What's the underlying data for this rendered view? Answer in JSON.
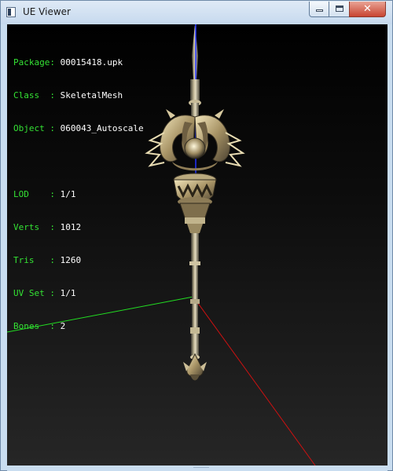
{
  "window": {
    "title": "UE Viewer"
  },
  "titlebar": {
    "min_icon": "minimize-icon",
    "max_icon": "maximize-icon",
    "close_icon": "close-icon",
    "close_glyph": "✕"
  },
  "info": {
    "package": {
      "key": "Package:",
      "value": "00015418.upk"
    },
    "class": {
      "key": "Class  :",
      "value": "SkeletalMesh"
    },
    "object": {
      "key": "Object :",
      "value": "060043_Autoscale"
    },
    "lod": {
      "key": "LOD    :",
      "value": "1/1"
    },
    "verts": {
      "key": "Verts  :",
      "value": "1012"
    },
    "tris": {
      "key": "Tris   :",
      "value": "1260"
    },
    "uvset": {
      "key": "UV Set :",
      "value": "1/1"
    },
    "bones": {
      "key": "Bones  :",
      "value": "2"
    }
  },
  "colors": {
    "info_key": "#34e234",
    "axis_x": "#cc1111",
    "axis_y": "#22dd22",
    "axis_z": "#2233ff",
    "viewport_bg": "#000000"
  }
}
